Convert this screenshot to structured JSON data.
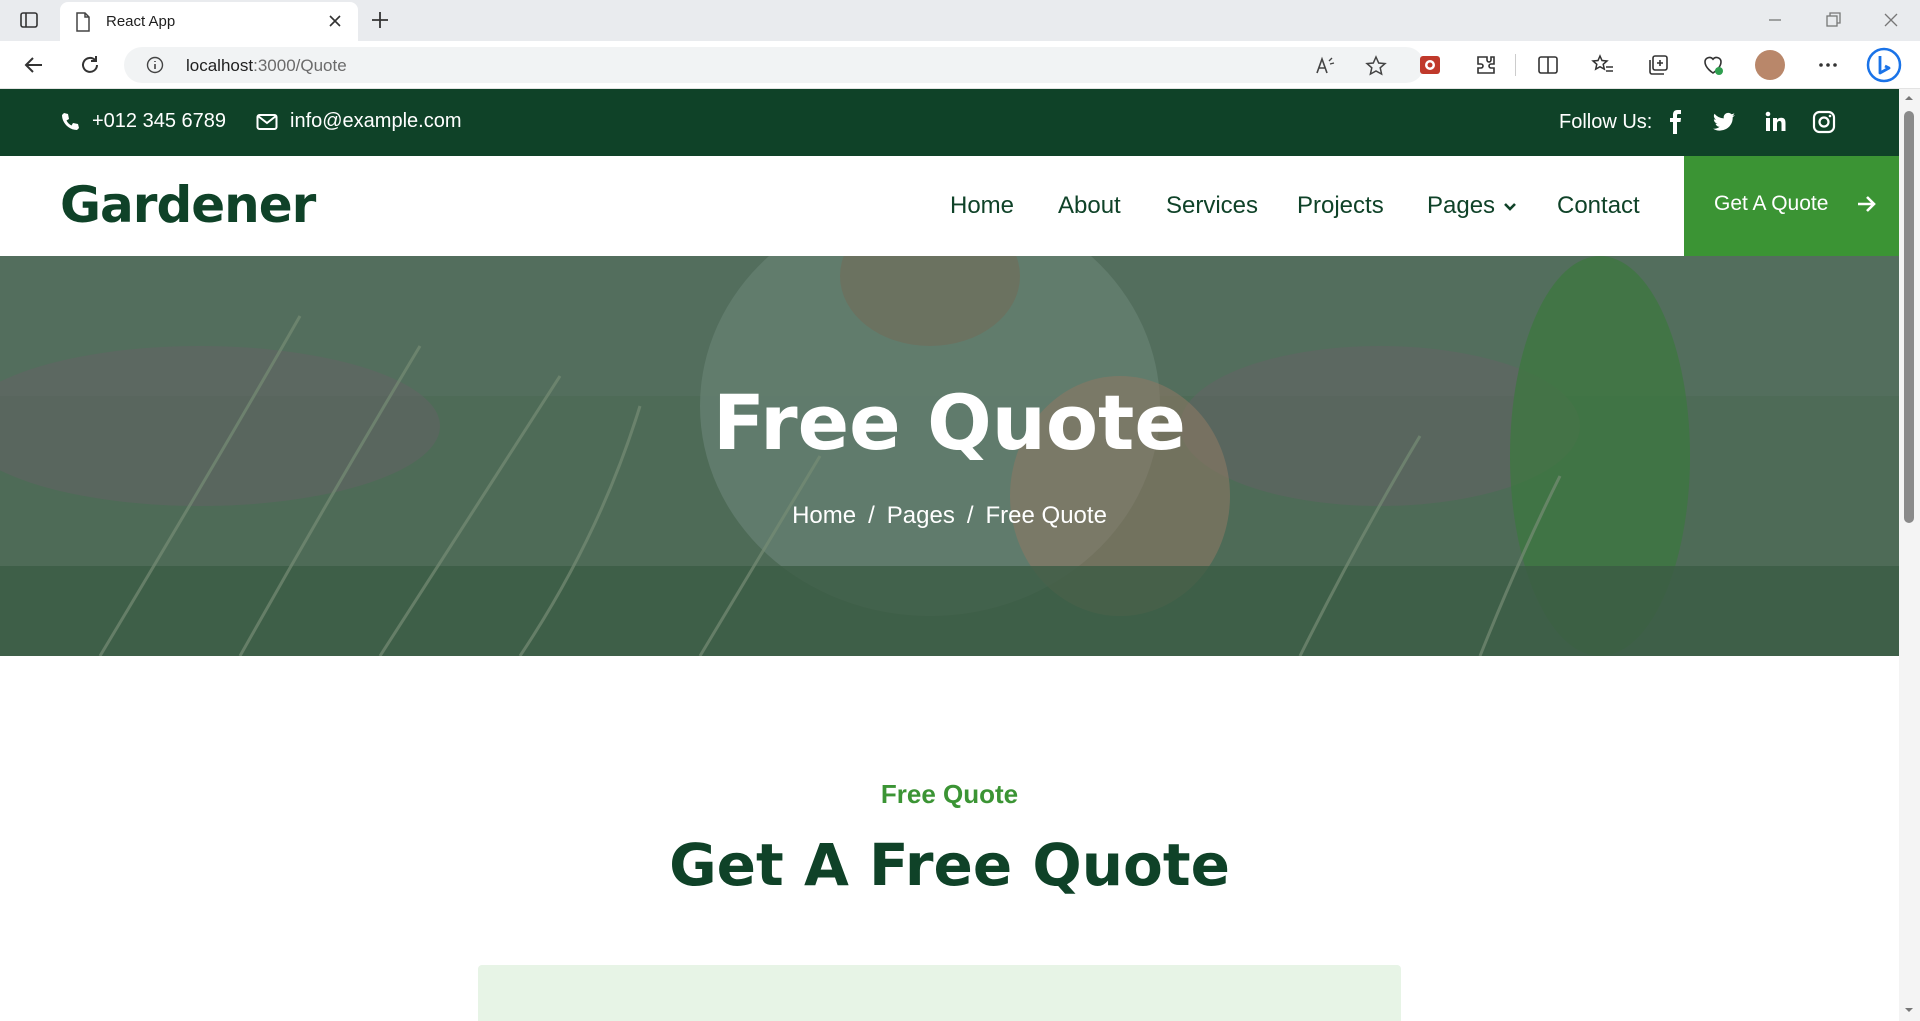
{
  "browser": {
    "tab_title": "React App",
    "url_host": "localhost",
    "url_path": ":3000/Quote"
  },
  "topbar": {
    "phone": "+012 345 6789",
    "email": "info@example.com",
    "follow_label": "Follow Us:",
    "social": [
      "facebook-icon",
      "twitter-icon",
      "linkedin-icon",
      "instagram-icon"
    ]
  },
  "navbar": {
    "brand": "Gardener",
    "menu": [
      "Home",
      "About",
      "Services",
      "Projects",
      "Pages",
      "Contact"
    ],
    "cta": "Get A Quote"
  },
  "hero": {
    "title": "Free Quote",
    "breadcrumb": [
      "Home",
      "Pages",
      "Free Quote"
    ]
  },
  "section": {
    "subtitle": "Free Quote",
    "title": "Get A Free Quote"
  },
  "colors": {
    "dark_green": "#0f4228",
    "accent_green": "#3b9434",
    "form_bg": "#e7f4e6"
  }
}
